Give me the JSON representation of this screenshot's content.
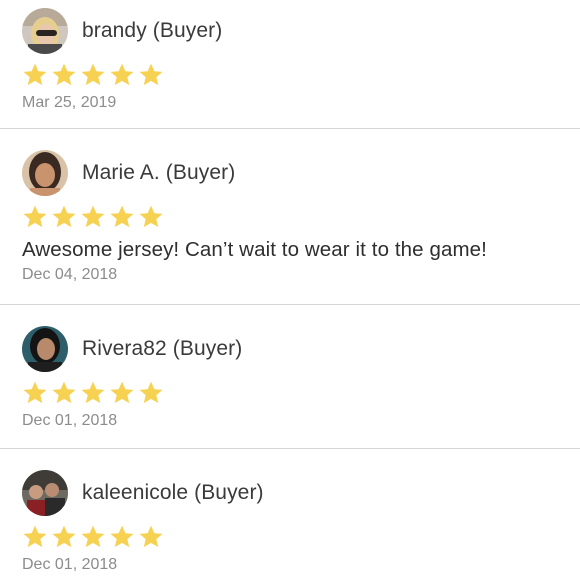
{
  "reviews": [
    {
      "name": "brandy (Buyer)",
      "avatar_icon": "user-photo-blonde-sunglasses",
      "rating": 5,
      "text": "",
      "date": "Mar 25, 2019"
    },
    {
      "name": "Marie A. (Buyer)",
      "avatar_icon": "user-photo-dark-hair",
      "rating": 5,
      "text": "Awesome jersey!  Can’t wait to wear it to the game!",
      "date": "Dec 04, 2018"
    },
    {
      "name": "Rivera82 (Buyer)",
      "avatar_icon": "user-photo-teal-dark-hair",
      "rating": 5,
      "text": "",
      "date": "Dec 01, 2018"
    },
    {
      "name": "kaleenicole (Buyer)",
      "avatar_icon": "user-photo-group",
      "rating": 5,
      "text": "",
      "date": "Dec 01, 2018"
    }
  ],
  "colors": {
    "star": "#f7d152",
    "divider": "#d6d6d6",
    "name": "#3a3a3a",
    "date": "#8c8c8c"
  }
}
